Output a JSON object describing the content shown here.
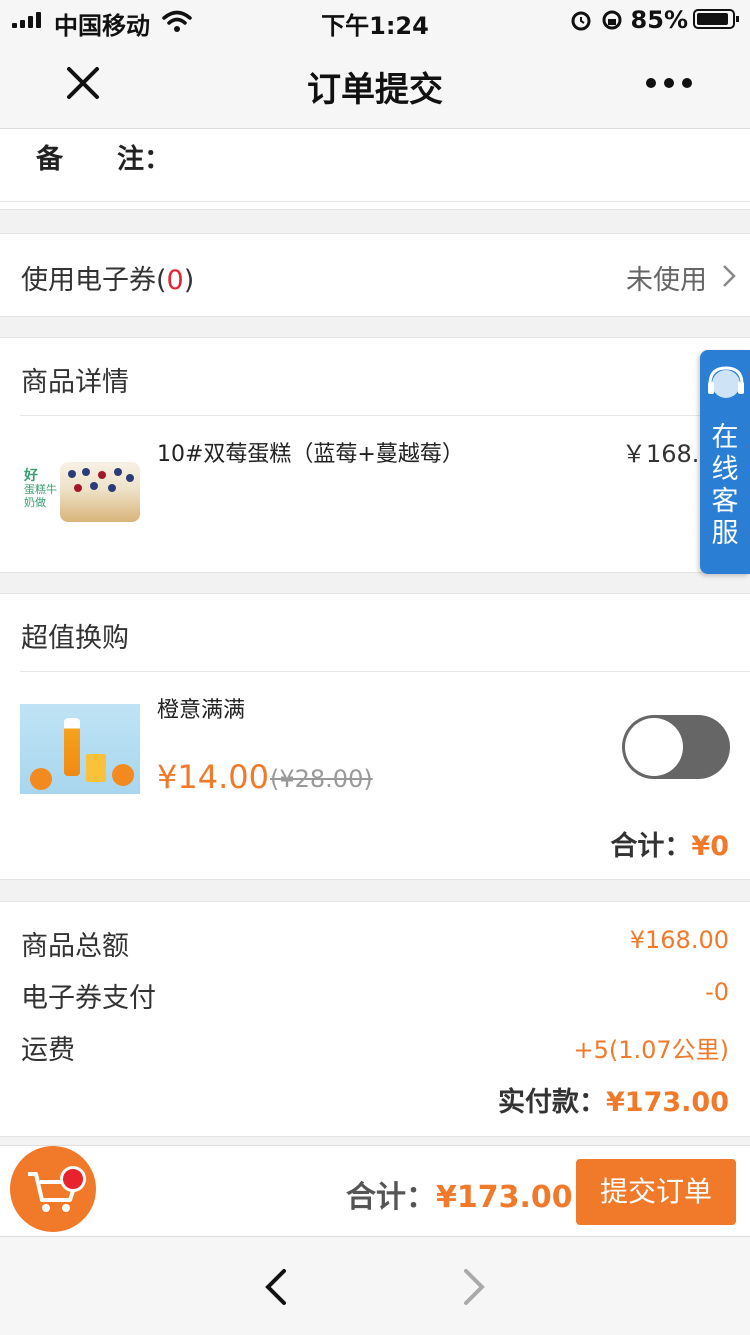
{
  "status_bar": {
    "carrier": "中国移动",
    "time": "下午1:24",
    "battery_percent": "85%"
  },
  "nav": {
    "title": "订单提交",
    "close_icon": "close-icon",
    "more_icon": "more-icon"
  },
  "remark": {
    "label": "备　　注："
  },
  "coupon": {
    "label": "使用电子券(",
    "count": "0",
    "close_paren": ")",
    "status": "未使用"
  },
  "product_details": {
    "title": "商品详情",
    "items": [
      {
        "name": "10#双莓蛋糕（蓝莓+蔓越莓）",
        "price": "￥168.",
        "logo_line1": "好",
        "logo_line2": "蛋糕牛奶做"
      }
    ]
  },
  "customer_service": {
    "label_chars": [
      "在",
      "线",
      "客",
      "服"
    ]
  },
  "upsell": {
    "title": "超值换购",
    "items": [
      {
        "name": "橙意满满",
        "price": "¥14.00",
        "original_price": "(¥28.00)",
        "toggle_on": false
      }
    ],
    "subtotal_label": "合计：",
    "subtotal_value": "¥0"
  },
  "summary": {
    "rows": [
      {
        "label": "商品总额",
        "value": "¥168.00"
      },
      {
        "label": "电子券支付",
        "value": "-0"
      },
      {
        "label": "运费",
        "value": "+5(1.07公里)"
      }
    ],
    "paid_label": "实付款：",
    "paid_value": "¥173.00"
  },
  "bottom_bar": {
    "total_label": "合计：",
    "total_value": "¥173.00",
    "submit_label": "提交订单"
  },
  "colors": {
    "accent": "#f07a2a",
    "badge_red": "#e8222e",
    "service_blue": "#2a7fd4"
  }
}
